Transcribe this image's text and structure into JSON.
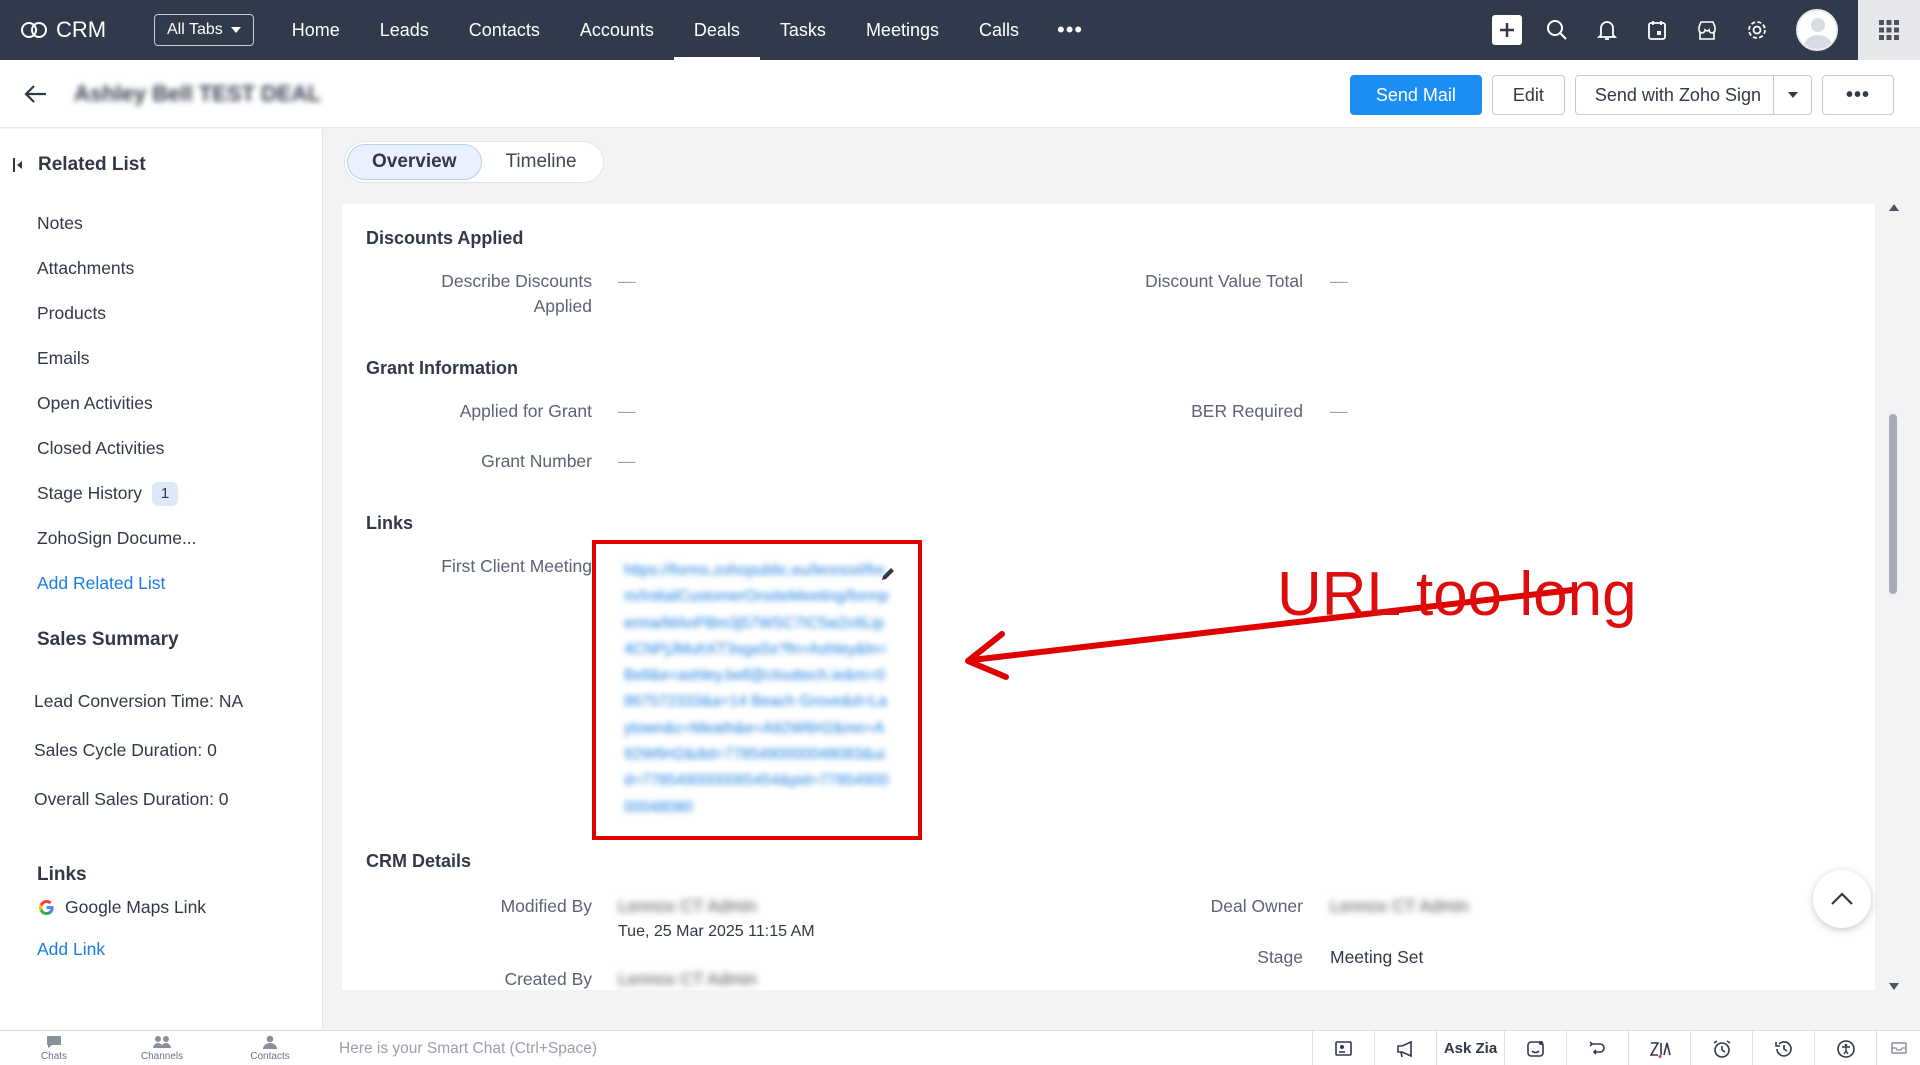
{
  "app": {
    "name": "CRM",
    "all_tabs": "All Tabs",
    "nav": [
      "Home",
      "Leads",
      "Contacts",
      "Accounts",
      "Deals",
      "Tasks",
      "Meetings",
      "Calls"
    ],
    "active_nav": "Deals"
  },
  "record": {
    "title": "Ashley Bell TEST DEAL",
    "send_mail": "Send Mail",
    "edit": "Edit",
    "send_zoho_sign": "Send with Zoho Sign"
  },
  "sidebar": {
    "related_list_title": "Related List",
    "items": [
      {
        "label": "Notes"
      },
      {
        "label": "Attachments"
      },
      {
        "label": "Products"
      },
      {
        "label": "Emails"
      },
      {
        "label": "Open Activities"
      },
      {
        "label": "Closed Activities"
      },
      {
        "label": "Stage History",
        "badge": "1"
      },
      {
        "label": "ZohoSign Docume..."
      }
    ],
    "add_related_list": "Add Related List",
    "sales_summary_title": "Sales Summary",
    "lead_conversion": "Lead Conversion Time: NA",
    "sales_cycle": "Sales Cycle Duration: 0",
    "overall_sales": "Overall Sales Duration: 0",
    "links_title": "Links",
    "google_maps": "Google Maps Link",
    "add_link": "Add Link"
  },
  "tabs": {
    "overview": "Overview",
    "timeline": "Timeline"
  },
  "details": {
    "discounts_title": "Discounts Applied",
    "describe_discounts_line1": "Describe Discounts",
    "describe_discounts_line2": "Applied",
    "describe_discounts_value": "—",
    "discount_value_total": "Discount Value Total",
    "discount_value_total_value": "—",
    "grant_title": "Grant Information",
    "applied_for_grant": "Applied for Grant",
    "applied_for_grant_value": "—",
    "ber_required": "BER Required",
    "ber_required_value": "—",
    "grant_number": "Grant Number",
    "grant_number_value": "—",
    "links_title": "Links",
    "first_client_meeting": "First Client Meeting",
    "first_client_meeting_url": "https://forms.zohopublic.eu/lennoxl/form/InitialCustomerOnsiteMeeting/formperma/MAnPBm3j57WSC7IC5w2c6Lip4CNPjJMuhXT3sgaSx?fn=Ashley&ln=Bell&e=ashley.bell@clouttech.ie&m=0867572333&a=14 Beach Grove&d=Laytown&c=Meath&e=A92W6H2&mn=A92W6H2&did=7785490000048083&uid=7785490000065454&pid=7785490000048080",
    "annotation": "URL too long",
    "crm_title": "CRM Details",
    "modified_by": "Modified By",
    "modified_by_value": "Lennox CT Admin",
    "modified_time": "Tue, 25 Mar 2025 11:15 AM",
    "created_by": "Created By",
    "created_by_value": "Lennox CT Admin",
    "deal_owner": "Deal Owner",
    "deal_owner_value": "Lennox CT Admin",
    "stage": "Stage",
    "stage_value": "Meeting Set"
  },
  "bottom": {
    "chats": "Chats",
    "channels": "Channels",
    "contacts": "Contacts",
    "smart_chat_placeholder": "Here is your Smart Chat (Ctrl+Space)",
    "ask_zia": "Ask Zia"
  },
  "colors": {
    "topbar": "#303a4a",
    "primary": "#1a8ef5",
    "link": "#1a7ee0",
    "annotation": "#e00000"
  }
}
